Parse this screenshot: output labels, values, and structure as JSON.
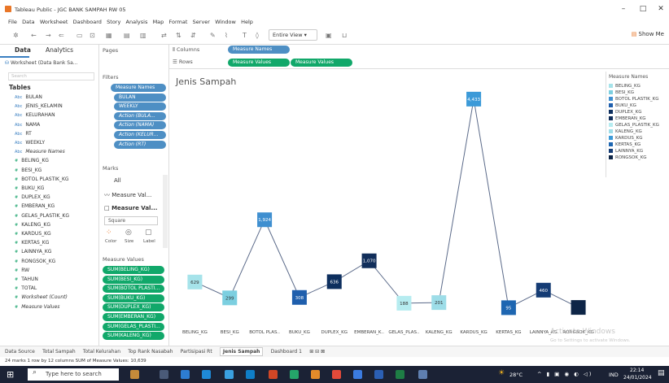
{
  "window": {
    "title": "Tableau Public - JGC BANK SAMPAH RW 05",
    "controls": [
      "–",
      "□",
      "✕"
    ]
  },
  "menu": [
    "File",
    "Data",
    "Worksheet",
    "Dashboard",
    "Story",
    "Analysis",
    "Map",
    "Format",
    "Server",
    "Window",
    "Help"
  ],
  "toolbar": {
    "view_select": "Entire View",
    "show_me": "Show Me"
  },
  "data_pane": {
    "tabs": [
      "Data",
      "Analytics"
    ],
    "source": "Worksheet (Data Bank Sa...",
    "search_placeholder": "Search",
    "tables_label": "Tables",
    "dimensions": [
      "BULAN",
      "JENIS_KELAMIN",
      "KELURAHAN",
      "NAMA",
      "RT",
      "WEEKLY"
    ],
    "measure_names": "Measure Names",
    "measures": [
      "BELING_KG",
      "BESI_KG",
      "BOTOL PLASTIK_KG",
      "BUKU_KG",
      "DUPLEX_KG",
      "EMBERAN_KG",
      "GELAS_PLASTIK_KG",
      "KALENG_KG",
      "KARDUS_KG",
      "KERTAS_KG",
      "LAINNYA_KG",
      "RONGSOK_KG",
      "RW",
      "TAHUN",
      "TOTAL"
    ],
    "italic_measures": [
      "Worksheet (Count)",
      "Measure Values"
    ]
  },
  "shelves": {
    "pages_label": "Pages",
    "filters_label": "Filters",
    "filters": [
      "Measure Names",
      "BULAN",
      "WEEKLY",
      "Action (BULA...",
      "Action (NAMA)",
      "Action (KELUR...",
      "Action (RT)"
    ],
    "marks_label": "Marks",
    "marks_items": [
      "All",
      "Measure Val...",
      "Measure Val..."
    ],
    "mark_type": "Square",
    "mark_buttons": [
      "Color",
      "Size",
      "Label"
    ],
    "measure_values_label": "Measure Values",
    "measure_values": [
      "SUM(BELING_KG)",
      "SUM(BESI_KG)",
      "SUM(BOTOL PLASTI...",
      "SUM(BUKU_KG)",
      "SUM(DUPLEX_KG)",
      "SUM(EMBERAN_KG)",
      "SUM(GELAS_PLASTI...",
      "SUM(KALENG_KG)"
    ]
  },
  "columns": {
    "label": "Columns",
    "pills": [
      "Measure Names"
    ]
  },
  "rows": {
    "label": "Rows",
    "pills": [
      "Measure Values",
      "Measure Values"
    ]
  },
  "legend": {
    "title": "Measure Names",
    "items": [
      {
        "label": "BELING_KG",
        "color": "#a6e3ea"
      },
      {
        "label": "BESI_KG",
        "color": "#7ccfe0"
      },
      {
        "label": "BOTOL PLASTIK_KG",
        "color": "#3f8fd0"
      },
      {
        "label": "BUKU_KG",
        "color": "#1f5fad"
      },
      {
        "label": "DUPLEX_KG",
        "color": "#0d2f5e"
      },
      {
        "label": "EMBERAN_KG",
        "color": "#112e5a"
      },
      {
        "label": "GELAS_PLASTIK_KG",
        "color": "#b6ecf0"
      },
      {
        "label": "KALENG_KG",
        "color": "#9ddde8"
      },
      {
        "label": "KARDUS_KG",
        "color": "#3c9ad8"
      },
      {
        "label": "KERTAS_KG",
        "color": "#1e66b1"
      },
      {
        "label": "LAINNYA_KG",
        "color": "#153c74"
      },
      {
        "label": "RONGSOK_KG",
        "color": "#0e2547"
      }
    ]
  },
  "chart_data": {
    "type": "line",
    "title": "Jenis Sampah",
    "categories": [
      "BELING_KG",
      "BESI_KG",
      "BOTOL PLAS..",
      "BUKU_KG",
      "DUPLEX_KG",
      "EMBERAN_K..",
      "GELAS_PLAS..",
      "KALENG_KG",
      "KARDUS_KG",
      "KERTAS_KG",
      "LAINNYA_KG",
      "RONGSOK_KG"
    ],
    "values": [
      629,
      299,
      1924,
      308,
      636,
      1070,
      188,
      201,
      4433,
      95,
      460,
      100
    ],
    "labels": [
      "629",
      "299",
      "1,924",
      "308",
      "636",
      "1,070",
      "188",
      "201",
      "4,433",
      "95",
      "460",
      ""
    ],
    "ylim": [
      0,
      4600
    ],
    "colors": [
      "#a6e3ea",
      "#7ccfe0",
      "#3f8fd0",
      "#1f5fad",
      "#0d2f5e",
      "#112e5a",
      "#b6ecf0",
      "#9ddde8",
      "#3c9ad8",
      "#1e66b1",
      "#153c74",
      "#0e2547"
    ],
    "line_color": "#5c6b8a",
    "mark": "square"
  },
  "sheet_tabs": [
    "Data Source",
    "Total Sampah",
    "Total Kelurahan",
    "Top Rank Nasabah",
    "Partisipasi Rt",
    "Jenis Sampah",
    "Dashboard 1"
  ],
  "active_tab": "Jenis Sampah",
  "status": "24 marks   1 row by 12 columns   SUM of Measure Values: 10,639",
  "watermark": {
    "title": "Activate Windows",
    "sub": "Go to Settings to activate Windows."
  },
  "taskbar": {
    "search_placeholder": "Type here to search",
    "weather": "28°C",
    "lang": "IND",
    "time": "22:14",
    "date": "24/01/2024"
  }
}
